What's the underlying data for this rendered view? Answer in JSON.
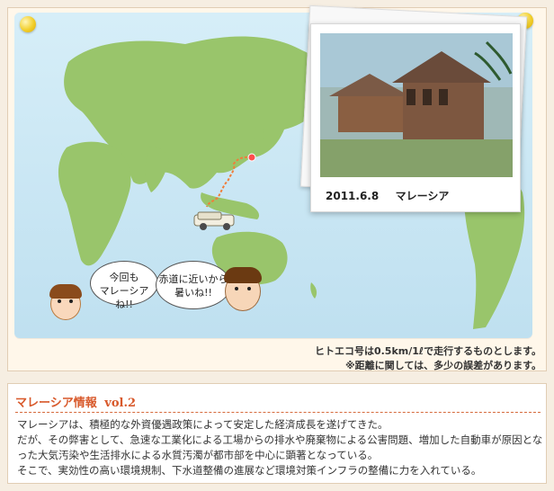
{
  "photo": {
    "date": "2011.6.8",
    "location": "マレーシア"
  },
  "speech": {
    "left": "今回も\nマレーシアね!!",
    "right": "赤道に近いから\n暑いね!!"
  },
  "notes": {
    "fuel": "ヒトエコ号は0.5km/1ℓで走行するものとします。",
    "distance": "※距離に関しては、多少の誤差があります。"
  },
  "info": {
    "title": "マレーシア情報",
    "volume": "vol.2",
    "body": "マレーシアは、積極的な外資優遇政策によって安定した経済成長を遂げてきた。\nだが、その弊害として、急速な工業化による工場からの排水や廃棄物による公害問題、増加した自動車が原因となった大気汚染や生活排水による水質汚濁が都市部を中心に顕著となっている。\nそこで、実効性の高い環境規制、下水道整備の進展など環境対策インフラの整備に力を入れている。"
  },
  "colors": {
    "sea": "#cfe9f6",
    "land": "#99c56b",
    "route": "#f07d3a",
    "title_accent": "#d8592b"
  },
  "icons": [
    "thumbtack-icon",
    "car-icon",
    "route-marker-icon"
  ]
}
